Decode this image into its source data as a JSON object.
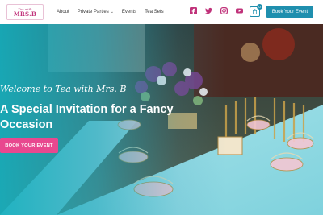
{
  "brand": {
    "logo_small": "Tea with",
    "logo_main": "MRS.B"
  },
  "nav": {
    "items": [
      {
        "label": "About"
      },
      {
        "label": "Private Parties"
      },
      {
        "label": "Events"
      },
      {
        "label": "Tea Sets"
      }
    ]
  },
  "socials": [
    "facebook-icon",
    "twitter-icon",
    "instagram-icon",
    "youtube-icon"
  ],
  "cart": {
    "count": "0"
  },
  "header_cta": {
    "label": "Book Your Event"
  },
  "hero": {
    "welcome": "Welcome to Tea with Mrs. B",
    "title": "A Special Invitation for a Fancy Occasion",
    "cta": "BOOK YOUR EVENT"
  },
  "colors": {
    "accent": "#1f8fae",
    "pink": "#e8488f",
    "brand_pink": "#c0327a",
    "overlay_teal": "#16afbe"
  }
}
